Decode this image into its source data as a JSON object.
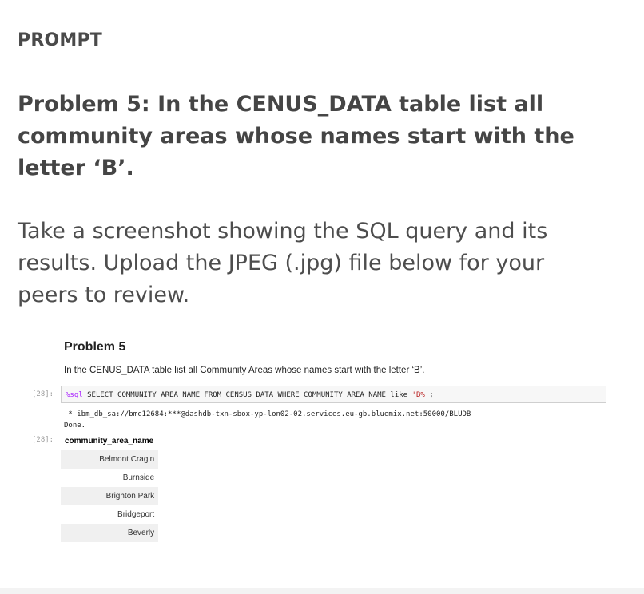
{
  "prompt_label": "PROMPT",
  "problem": {
    "title": "Problem 5: In the CENUS_DATA table list all community areas whose names start with the letter ‘B’.",
    "instructions": "Take a screenshot showing the SQL query and its results. Upload the JPEG (.jpg) file below for your peers to review."
  },
  "notebook": {
    "heading": "Problem 5",
    "description": "In the CENUS_DATA table list all Community Areas whose names start with the letter ‘B’.",
    "input_prompt": "[28]:",
    "output_prompt": "[28]:",
    "code": {
      "magic": "%sql",
      "query": " SELECT COMMUNITY_AREA_NAME FROM CENSUS_DATA WHERE COMMUNITY_AREA_NAME like ",
      "pattern": "'B%'",
      "terminator": ";"
    },
    "stdout_lines": [
      " * ibm_db_sa://bmc12684:***@dashdb-txn-sbox-yp-lon02-02.services.eu-gb.bluemix.net:50000/BLUDB",
      "Done."
    ],
    "result": {
      "column": "community_area_name",
      "rows": [
        "Belmont Cragin",
        "Burnside",
        "Brighton Park",
        "Bridgeport",
        "Beverly"
      ]
    }
  }
}
